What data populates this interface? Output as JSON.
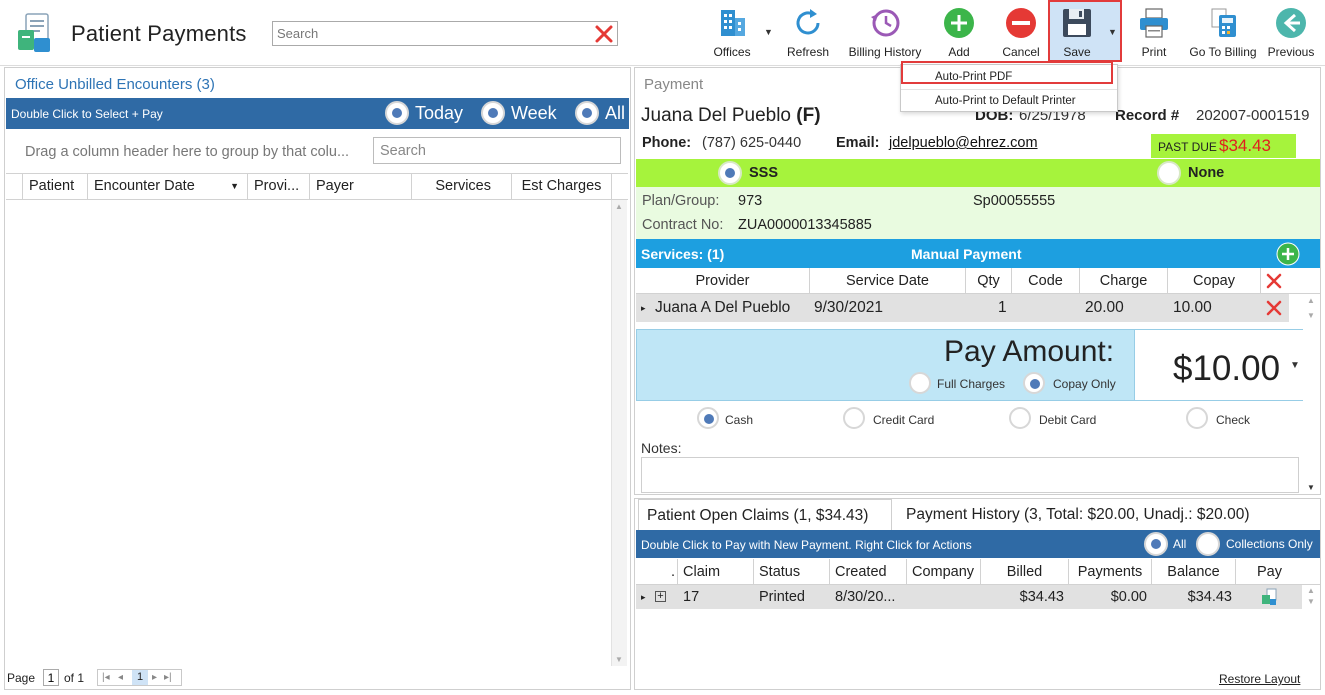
{
  "header": {
    "title": "Patient Payments",
    "search_placeholder": "Search",
    "toolbar": {
      "offices": "Offices",
      "refresh": "Refresh",
      "billing_history": "Billing History",
      "add": "Add",
      "cancel": "Cancel",
      "save": "Save",
      "print": "Print",
      "go_to_billing": "Go To Billing",
      "previous": "Previous"
    },
    "save_menu": [
      "Auto-Print PDF",
      "Auto-Print to  Default Printer"
    ]
  },
  "left": {
    "title": "Office Unbilled Encounters (3)",
    "bar_text": "Double Click to Select + Pay",
    "filters": [
      "Today",
      "Week",
      "All"
    ],
    "group_hint": "Drag a column header here to group by that colu...",
    "search_placeholder": "Search",
    "columns": [
      "Patient",
      "Encounter Date",
      "Provi...",
      "Payer",
      "Services",
      "Est Charges"
    ],
    "pager": {
      "page_label": "Page",
      "page_value": "1",
      "of_label": "of 1",
      "current": "1"
    }
  },
  "payment": {
    "section_label": "Payment",
    "patient_name": "Juana Del Pueblo",
    "sex": "(F)",
    "dob_label": "DOB:",
    "dob": "6/25/1978",
    "record_label": "Record #",
    "record": "202007-0001519",
    "phone_label": "Phone:",
    "phone": "(787) 625-0440",
    "email_label": "Email:",
    "email": "jdelpueblo@ehrez.com",
    "past_due_label": "PAST DUE",
    "past_due_amount": "$34.43",
    "insurance_options": [
      "SSS",
      "None"
    ],
    "plan_group_label": "Plan/Group:",
    "plan_group": "973",
    "plan_id": "Sp00055555",
    "contract_label": "Contract No:",
    "contract": "ZUA0000013345885",
    "services_title": "Services: (1)",
    "manual_payment": "Manual Payment",
    "service_columns": [
      "Provider",
      "Service Date",
      "Qty",
      "Code",
      "Charge",
      "Copay"
    ],
    "services": [
      {
        "provider": "Juana A Del Pueblo",
        "date": "9/30/2021",
        "qty": "1",
        "code": "",
        "charge": "20.00",
        "copay": "10.00"
      }
    ],
    "pay_amount_label": "Pay Amount:",
    "pay_amount": "$10.00",
    "charge_options": [
      "Full Charges",
      "Copay Only"
    ],
    "methods": [
      "Cash",
      "Credit Card",
      "Debit Card",
      "Check"
    ],
    "notes_label": "Notes:"
  },
  "claims": {
    "tabs": [
      "Patient Open Claims (1, $34.43)",
      "Payment History (3, Total: $20.00, Unadj.: $20.00)"
    ],
    "bar_text": "Double Click to Pay with New Payment. Right Click for Actions",
    "filters": [
      "All",
      "Collections Only"
    ],
    "columns": [
      ".",
      "Claim",
      "Status",
      "Created",
      "Company",
      "Billed",
      "Payments",
      "Balance",
      "Pay"
    ],
    "rows": [
      {
        "claim": "17",
        "status": "Printed",
        "created": "8/30/20...",
        "company": "",
        "billed": "$34.43",
        "payments": "$0.00",
        "balance": "$34.43"
      }
    ],
    "restore_layout": "Restore Layout"
  },
  "colors": {
    "accent_blue": "#2f6aa5",
    "services_blue": "#1d9fe0",
    "insurance_green": "#a6f33c",
    "past_due_red": "#e0201e",
    "highlight_red": "#e23b3b"
  }
}
